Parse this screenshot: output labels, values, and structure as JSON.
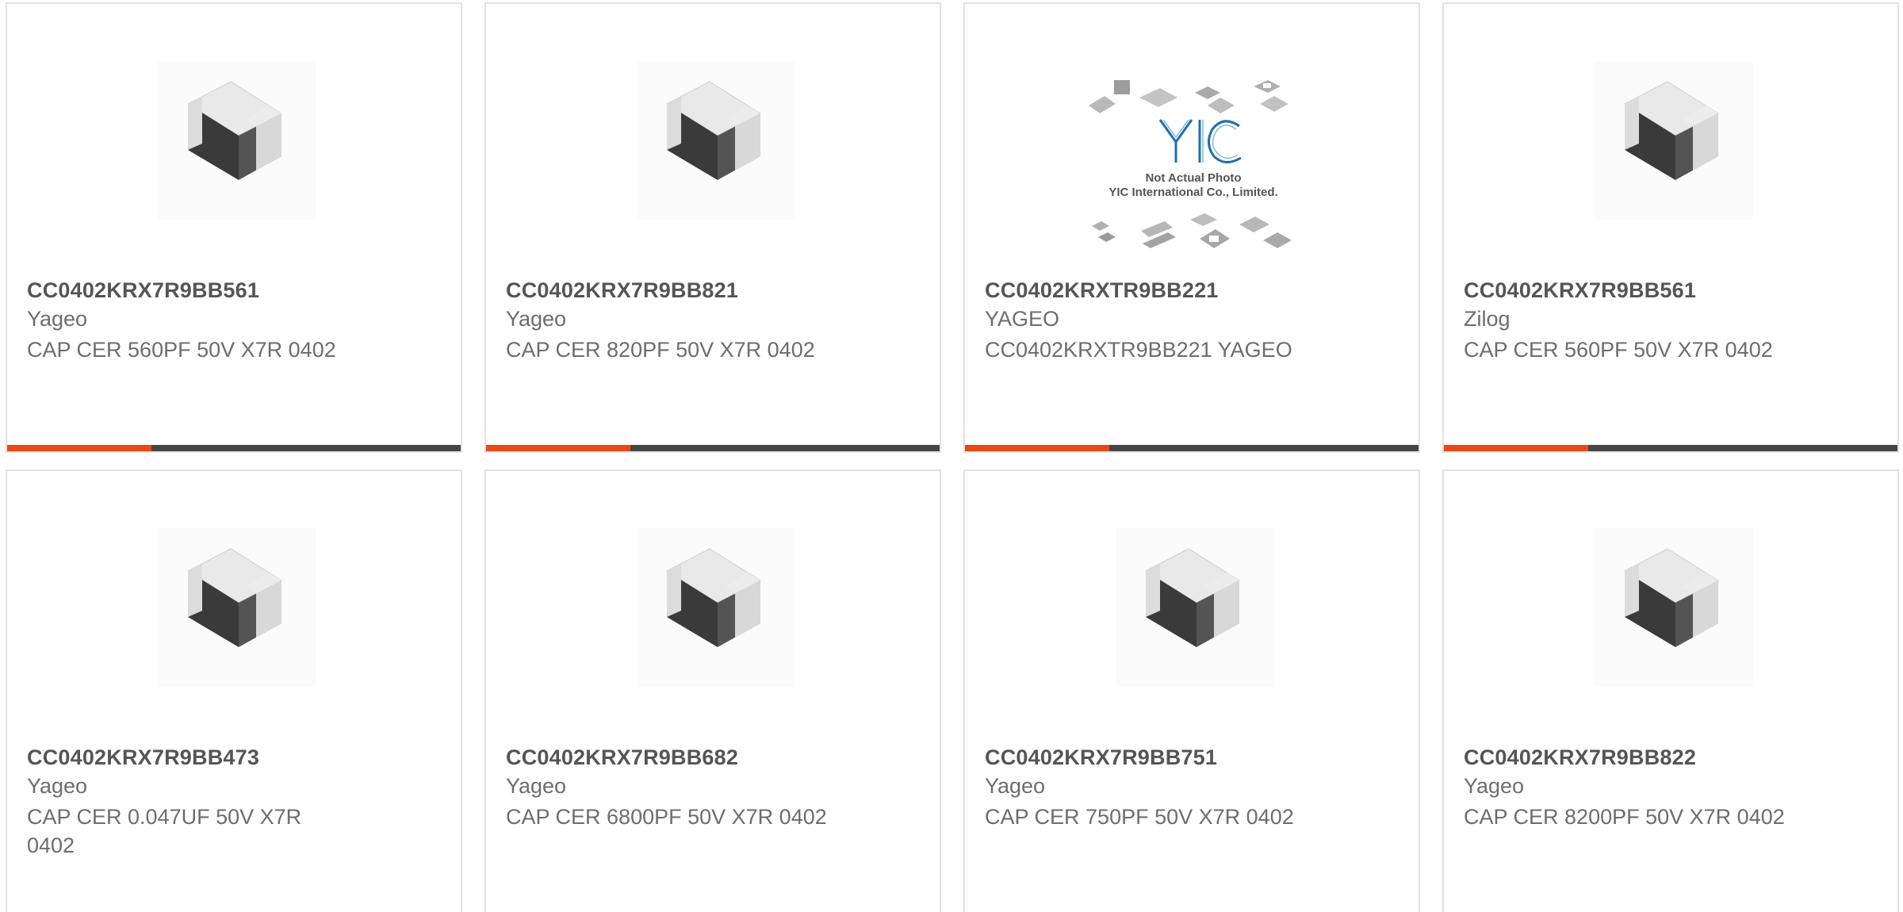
{
  "products": [
    {
      "part": "CC0402KRX7R9BB561",
      "brand": "Yageo",
      "desc": "CAP CER 560PF 50V X7R 0402",
      "image": "chip-capacitor-icon"
    },
    {
      "part": "CC0402KRX7R9BB821",
      "brand": "Yageo",
      "desc": "CAP CER 820PF 50V X7R 0402",
      "image": "chip-capacitor-icon"
    },
    {
      "part": "CC0402KRXTR9BB221",
      "brand": "YAGEO",
      "desc": "CC0402KRXTR9BB221 YAGEO",
      "image": "yic-placeholder-logo",
      "placeholder_line1": "Not Actual Photo",
      "placeholder_line2": "YIC International Co., Limited."
    },
    {
      "part": "CC0402KRX7R9BB561",
      "brand": "Zilog",
      "desc": "CAP CER 560PF 50V X7R 0402",
      "image": "chip-capacitor-icon"
    },
    {
      "part": "CC0402KRX7R9BB473",
      "brand": "Yageo",
      "desc": "CAP CER 0.047UF 50V X7R 0402",
      "image": "chip-capacitor-icon"
    },
    {
      "part": "CC0402KRX7R9BB682",
      "brand": "Yageo",
      "desc": "CAP CER 6800PF 50V X7R 0402",
      "image": "chip-capacitor-icon"
    },
    {
      "part": "CC0402KRX7R9BB751",
      "brand": "Yageo",
      "desc": "CAP CER 750PF 50V X7R 0402",
      "image": "chip-capacitor-icon"
    },
    {
      "part": "CC0402KRX7R9BB822",
      "brand": "Yageo",
      "desc": "CAP CER 8200PF 50V X7R 0402",
      "image": "chip-capacitor-icon"
    }
  ],
  "colors": {
    "accent": "#ea4815",
    "bar_dark": "#454545",
    "card_border": "#e2e2e2"
  }
}
